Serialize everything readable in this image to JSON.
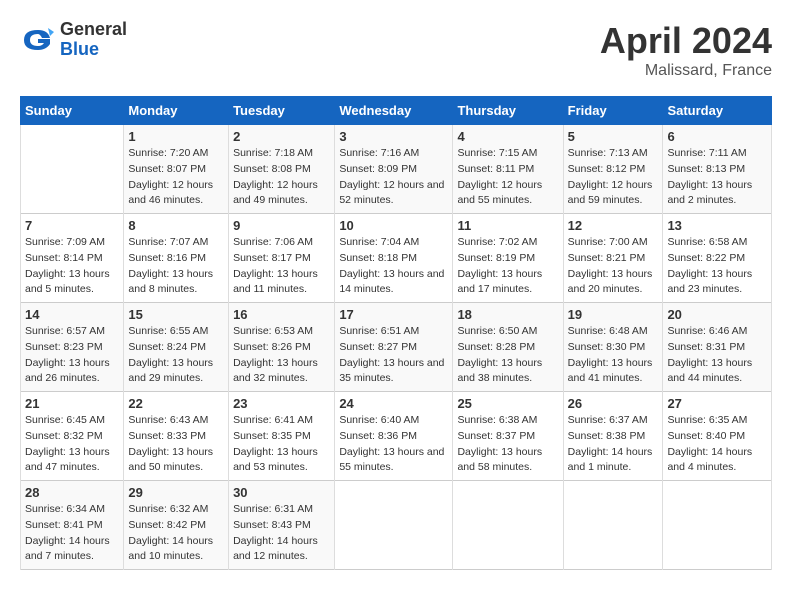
{
  "header": {
    "logo_general": "General",
    "logo_blue": "Blue",
    "month_title": "April 2024",
    "location": "Malissard, France"
  },
  "columns": [
    "Sunday",
    "Monday",
    "Tuesday",
    "Wednesday",
    "Thursday",
    "Friday",
    "Saturday"
  ],
  "weeks": [
    [
      null,
      {
        "day": 1,
        "sunrise": "7:20 AM",
        "sunset": "8:07 PM",
        "daylight": "12 hours and 46 minutes."
      },
      {
        "day": 2,
        "sunrise": "7:18 AM",
        "sunset": "8:08 PM",
        "daylight": "12 hours and 49 minutes."
      },
      {
        "day": 3,
        "sunrise": "7:16 AM",
        "sunset": "8:09 PM",
        "daylight": "12 hours and 52 minutes."
      },
      {
        "day": 4,
        "sunrise": "7:15 AM",
        "sunset": "8:11 PM",
        "daylight": "12 hours and 55 minutes."
      },
      {
        "day": 5,
        "sunrise": "7:13 AM",
        "sunset": "8:12 PM",
        "daylight": "12 hours and 59 minutes."
      },
      {
        "day": 6,
        "sunrise": "7:11 AM",
        "sunset": "8:13 PM",
        "daylight": "13 hours and 2 minutes."
      }
    ],
    [
      {
        "day": 7,
        "sunrise": "7:09 AM",
        "sunset": "8:14 PM",
        "daylight": "13 hours and 5 minutes."
      },
      {
        "day": 8,
        "sunrise": "7:07 AM",
        "sunset": "8:16 PM",
        "daylight": "13 hours and 8 minutes."
      },
      {
        "day": 9,
        "sunrise": "7:06 AM",
        "sunset": "8:17 PM",
        "daylight": "13 hours and 11 minutes."
      },
      {
        "day": 10,
        "sunrise": "7:04 AM",
        "sunset": "8:18 PM",
        "daylight": "13 hours and 14 minutes."
      },
      {
        "day": 11,
        "sunrise": "7:02 AM",
        "sunset": "8:19 PM",
        "daylight": "13 hours and 17 minutes."
      },
      {
        "day": 12,
        "sunrise": "7:00 AM",
        "sunset": "8:21 PM",
        "daylight": "13 hours and 20 minutes."
      },
      {
        "day": 13,
        "sunrise": "6:58 AM",
        "sunset": "8:22 PM",
        "daylight": "13 hours and 23 minutes."
      }
    ],
    [
      {
        "day": 14,
        "sunrise": "6:57 AM",
        "sunset": "8:23 PM",
        "daylight": "13 hours and 26 minutes."
      },
      {
        "day": 15,
        "sunrise": "6:55 AM",
        "sunset": "8:24 PM",
        "daylight": "13 hours and 29 minutes."
      },
      {
        "day": 16,
        "sunrise": "6:53 AM",
        "sunset": "8:26 PM",
        "daylight": "13 hours and 32 minutes."
      },
      {
        "day": 17,
        "sunrise": "6:51 AM",
        "sunset": "8:27 PM",
        "daylight": "13 hours and 35 minutes."
      },
      {
        "day": 18,
        "sunrise": "6:50 AM",
        "sunset": "8:28 PM",
        "daylight": "13 hours and 38 minutes."
      },
      {
        "day": 19,
        "sunrise": "6:48 AM",
        "sunset": "8:30 PM",
        "daylight": "13 hours and 41 minutes."
      },
      {
        "day": 20,
        "sunrise": "6:46 AM",
        "sunset": "8:31 PM",
        "daylight": "13 hours and 44 minutes."
      }
    ],
    [
      {
        "day": 21,
        "sunrise": "6:45 AM",
        "sunset": "8:32 PM",
        "daylight": "13 hours and 47 minutes."
      },
      {
        "day": 22,
        "sunrise": "6:43 AM",
        "sunset": "8:33 PM",
        "daylight": "13 hours and 50 minutes."
      },
      {
        "day": 23,
        "sunrise": "6:41 AM",
        "sunset": "8:35 PM",
        "daylight": "13 hours and 53 minutes."
      },
      {
        "day": 24,
        "sunrise": "6:40 AM",
        "sunset": "8:36 PM",
        "daylight": "13 hours and 55 minutes."
      },
      {
        "day": 25,
        "sunrise": "6:38 AM",
        "sunset": "8:37 PM",
        "daylight": "13 hours and 58 minutes."
      },
      {
        "day": 26,
        "sunrise": "6:37 AM",
        "sunset": "8:38 PM",
        "daylight": "14 hours and 1 minute."
      },
      {
        "day": 27,
        "sunrise": "6:35 AM",
        "sunset": "8:40 PM",
        "daylight": "14 hours and 4 minutes."
      }
    ],
    [
      {
        "day": 28,
        "sunrise": "6:34 AM",
        "sunset": "8:41 PM",
        "daylight": "14 hours and 7 minutes."
      },
      {
        "day": 29,
        "sunrise": "6:32 AM",
        "sunset": "8:42 PM",
        "daylight": "14 hours and 10 minutes."
      },
      {
        "day": 30,
        "sunrise": "6:31 AM",
        "sunset": "8:43 PM",
        "daylight": "14 hours and 12 minutes."
      },
      null,
      null,
      null,
      null
    ]
  ]
}
